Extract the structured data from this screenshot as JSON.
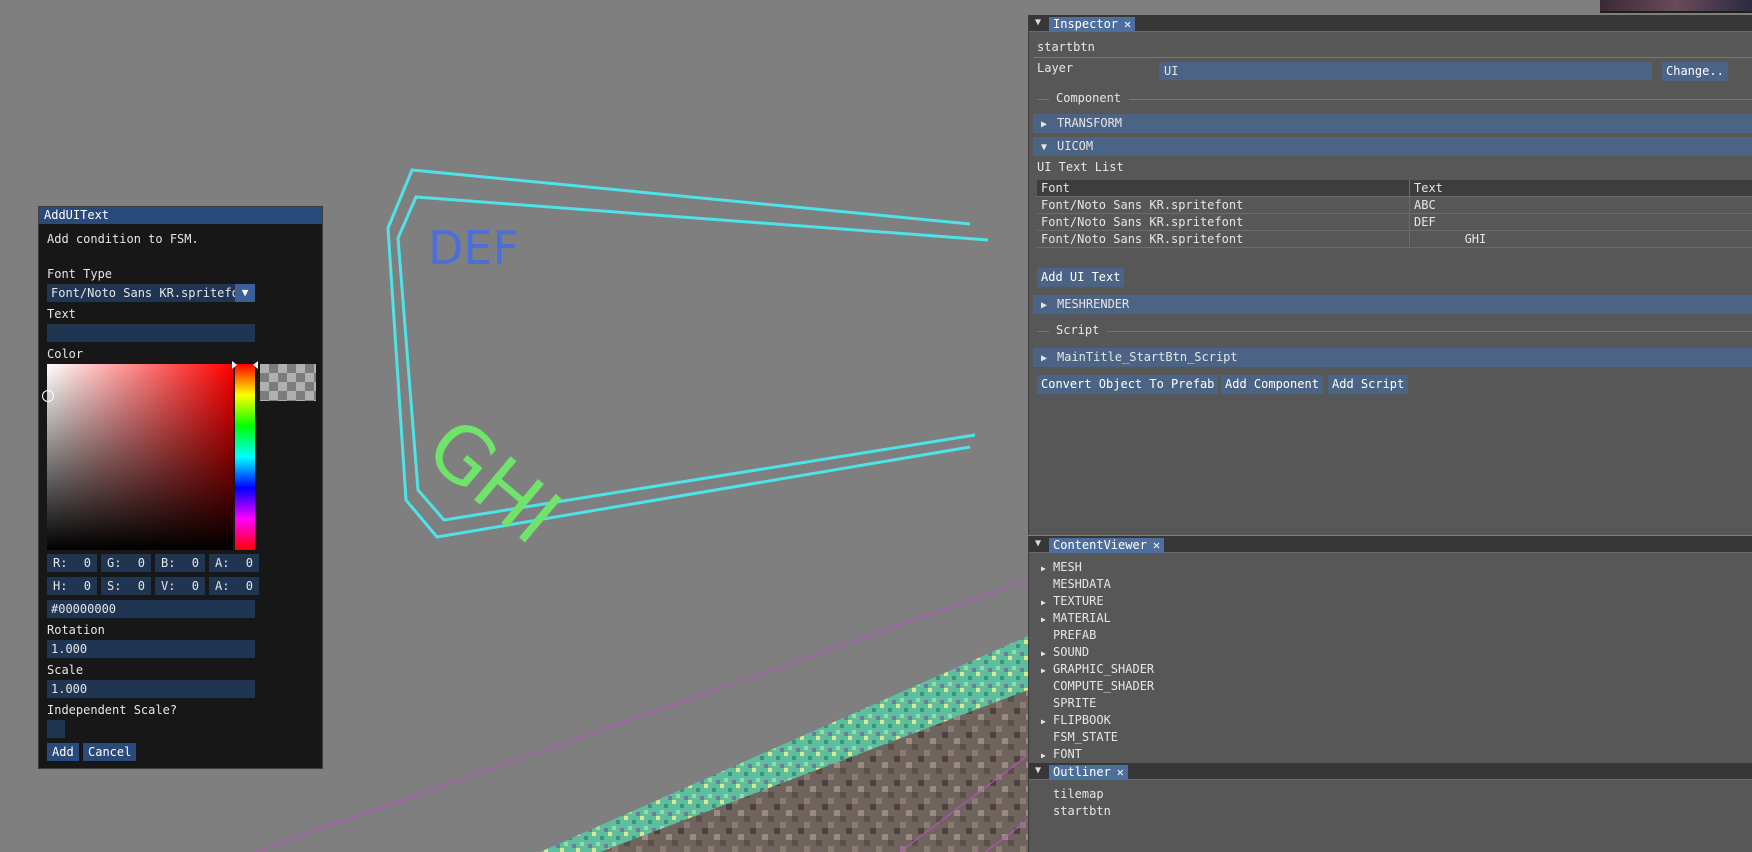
{
  "scene": {
    "label_def": "DEF",
    "label_ghi": "GHI"
  },
  "adduitext": {
    "title": "AddUIText",
    "description": "Add condition to FSM.",
    "font_type_label": "Font Type",
    "font_type_value": "Font/Noto Sans KR.spritefon",
    "text_label": "Text",
    "text_value": "",
    "color_label": "Color",
    "rgba": [
      {
        "k": "R:",
        "v": "0"
      },
      {
        "k": "G:",
        "v": "0"
      },
      {
        "k": "B:",
        "v": "0"
      },
      {
        "k": "A:",
        "v": "0"
      }
    ],
    "hsva": [
      {
        "k": "H:",
        "v": "0"
      },
      {
        "k": "S:",
        "v": "0"
      },
      {
        "k": "V:",
        "v": "0"
      },
      {
        "k": "A:",
        "v": "0"
      }
    ],
    "hex_value": "#00000000",
    "rotation_label": "Rotation",
    "rotation_value": "1.000",
    "scale_label": "Scale",
    "scale_value": "1.000",
    "independent_scale_label": "Independent Scale?",
    "add_label": "Add",
    "cancel_label": "Cancel"
  },
  "inspector": {
    "tab": "Inspector",
    "object_name": "startbtn",
    "layer_label": "Layer",
    "layer_value": "UI",
    "change_label": "Change..",
    "component_sep": "Component",
    "transform": "TRANSFORM",
    "uicom": "UICOM",
    "list_title": "UI Text List",
    "columns": [
      "Font",
      "Text"
    ],
    "rows": [
      {
        "font": "Font/Noto Sans KR.spritefont",
        "text": "ABC"
      },
      {
        "font": "Font/Noto Sans KR.spritefont",
        "text": "DEF"
      },
      {
        "font": "Font/Noto Sans KR.spritefont",
        "text": "       GHI"
      }
    ],
    "add_ui_text": "Add UI Text",
    "meshrender": "MESHRENDER",
    "script_sep": "Script",
    "script_name": "MainTitle_StartBtn_Script",
    "convert_prefab": "Convert Object To Prefab",
    "add_component": "Add Component",
    "add_script": "Add Script"
  },
  "contentviewer": {
    "tab": "ContentViewer",
    "items": [
      {
        "label": "MESH",
        "expandable": true
      },
      {
        "label": "MESHDATA",
        "expandable": false
      },
      {
        "label": "TEXTURE",
        "expandable": true
      },
      {
        "label": "MATERIAL",
        "expandable": true
      },
      {
        "label": "PREFAB",
        "expandable": false
      },
      {
        "label": "SOUND",
        "expandable": true
      },
      {
        "label": "GRAPHIC_SHADER",
        "expandable": true
      },
      {
        "label": "COMPUTE_SHADER",
        "expandable": false
      },
      {
        "label": "SPRITE",
        "expandable": false
      },
      {
        "label": "FLIPBOOK",
        "expandable": true
      },
      {
        "label": "FSM_STATE",
        "expandable": false
      },
      {
        "label": "FONT",
        "expandable": true
      }
    ]
  },
  "outliner": {
    "tab": "Outliner",
    "items": [
      "tilemap",
      "startbtn"
    ]
  },
  "colors": {
    "accent": "#4b6385",
    "field": "#203552",
    "outline": "#4ee3e8",
    "def_text": "#4a6fd8",
    "ghi_text": "#6fe36a"
  }
}
